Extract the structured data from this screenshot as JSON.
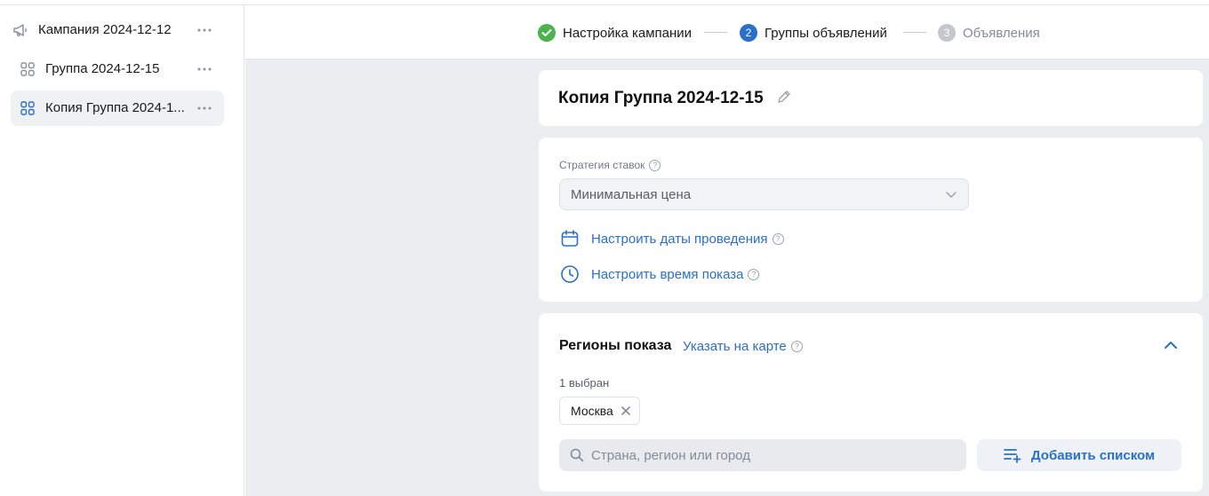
{
  "sidebar": {
    "items": [
      {
        "label": "Кампания 2024-12-12",
        "icon": "megaphone-icon"
      },
      {
        "label": "Группа 2024-12-15",
        "icon": "grid-icon"
      },
      {
        "label": "Копия Группа 2024-1...",
        "icon": "grid-icon",
        "active": true
      }
    ]
  },
  "steps": [
    {
      "label": "Настройка кампании",
      "state": "done"
    },
    {
      "label": "Группы объявлений",
      "number": "2",
      "state": "current"
    },
    {
      "label": "Объявления",
      "number": "3",
      "state": "pending"
    }
  ],
  "group": {
    "title": "Копия Группа 2024-12-15"
  },
  "strategy": {
    "label": "Стратегия ставок",
    "value": "Минимальная цена",
    "dates_link": "Настроить даты проведения",
    "time_link": "Настроить время показа"
  },
  "regions": {
    "title": "Регионы показа",
    "map_link": "Указать на карте",
    "count_text": "1 выбран",
    "chips": [
      "Москва"
    ],
    "search_placeholder": "Страна, регион или город",
    "add_list_label": "Добавить списком"
  },
  "colors": {
    "accent": "#2a6fc9",
    "done": "#4bb34b",
    "pending": "#c4c8cc"
  }
}
